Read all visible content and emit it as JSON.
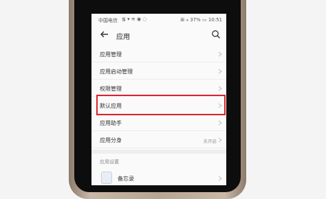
{
  "statusbar": {
    "carrier": "中国电信",
    "signal": "᯾ ▾ ≋ ◉ ◌",
    "right": "⊞ ⁎ 37% ▭ 10:51"
  },
  "header": {
    "title": "应用"
  },
  "menu": [
    {
      "label": "应用管理",
      "value": ""
    },
    {
      "label": "应用启动管理",
      "value": ""
    },
    {
      "label": "权限管理",
      "value": ""
    },
    {
      "label": "默认应用",
      "value": "",
      "highlighted": true
    },
    {
      "label": "应用助手",
      "value": ""
    },
    {
      "label": "应用分身",
      "value": "未开启"
    }
  ],
  "section": {
    "label": "应用设置"
  },
  "app_item": {
    "label": "备忘录"
  },
  "colors": {
    "highlight": "#d9222a",
    "phone_frame": "#b7a492"
  }
}
